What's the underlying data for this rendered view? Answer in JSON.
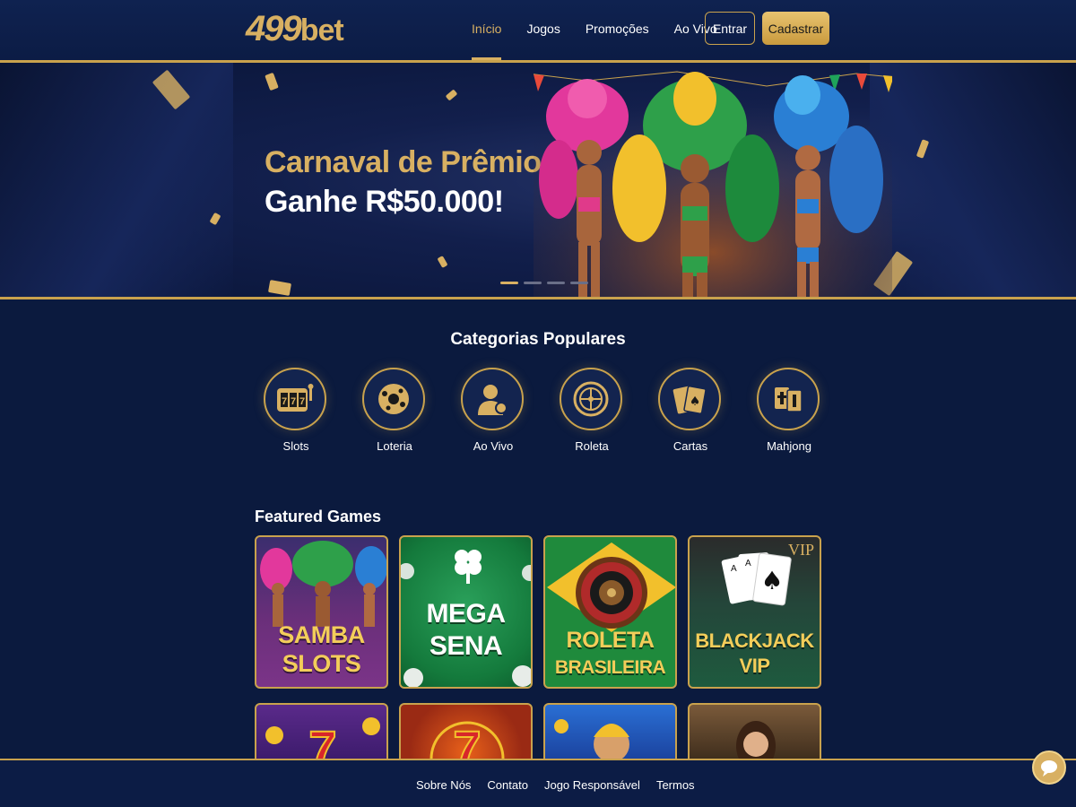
{
  "brand": {
    "logo_number": "499",
    "logo_suffix": "bet"
  },
  "nav": {
    "items": [
      {
        "label": "Início",
        "active": true
      },
      {
        "label": "Jogos"
      },
      {
        "label": "Promoções"
      },
      {
        "label": "Ao Vivo"
      }
    ],
    "login_label": "Entrar",
    "signup_label": "Cadastrar"
  },
  "hero": {
    "title_line1": "Carnaval de Prêmios!",
    "title_line2": "Ganhe R$50.000!",
    "slides": 4,
    "active_slide": 1
  },
  "categories": {
    "title": "Categorias Populares",
    "items": [
      {
        "label": "Slots",
        "icon": "slot-machine-icon"
      },
      {
        "label": "Loteria",
        "icon": "lottery-ball-icon"
      },
      {
        "label": "Ao Vivo",
        "icon": "live-dealer-icon"
      },
      {
        "label": "Roleta",
        "icon": "roulette-icon"
      },
      {
        "label": "Cartas",
        "icon": "cards-icon"
      },
      {
        "label": "Mahjong",
        "icon": "mahjong-icon"
      }
    ]
  },
  "featured": {
    "title": "Featured Games",
    "games": [
      {
        "name_line1": "SAMBA",
        "name_line2": "SLOTS"
      },
      {
        "name_line1": "MEGA",
        "name_line2": "SENA"
      },
      {
        "name_line1": "ROLETA",
        "name_line2": "BRASILEIRA"
      },
      {
        "name_line1": "BLACKJACK",
        "name_line2": "VIP",
        "badge": "VIP"
      }
    ]
  },
  "footer": {
    "links": [
      "Sobre Nós",
      "Contato",
      "Jogo Responsável",
      "Termos"
    ]
  },
  "colors": {
    "gold": "#d8b062",
    "navy": "#0b1a3e",
    "border_gold": "#c9a24d"
  }
}
